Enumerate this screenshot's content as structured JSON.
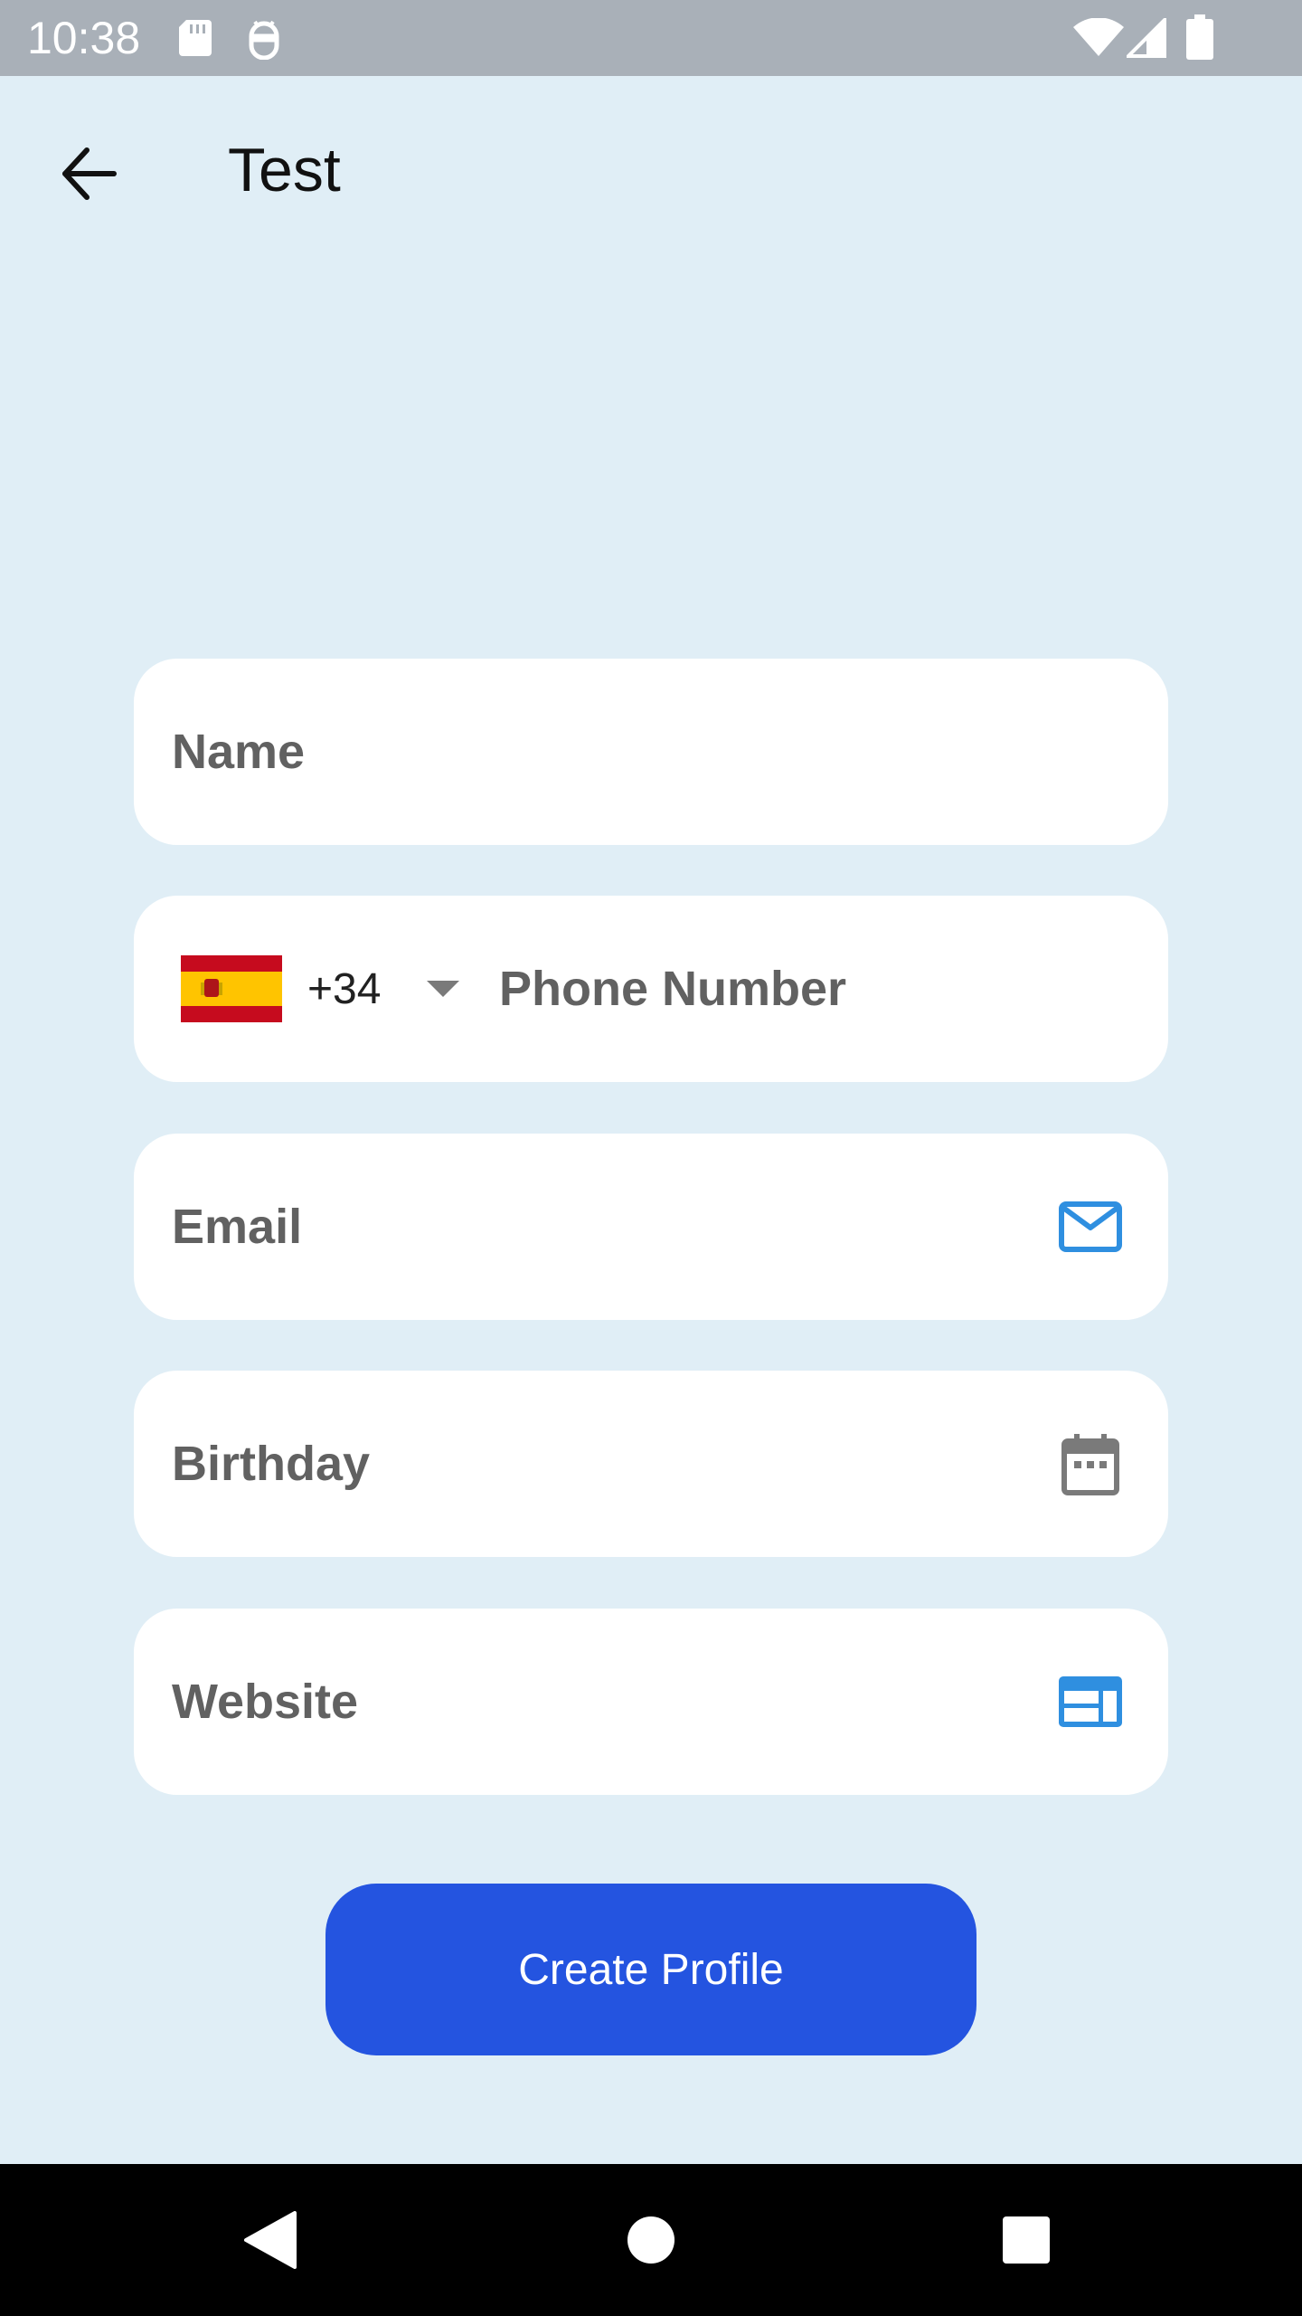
{
  "status_bar": {
    "time": "10:38",
    "left_icons": [
      "sd-card-icon",
      "android-debug-icon"
    ],
    "right_icons": [
      "wifi-icon",
      "cell-signal-icon",
      "battery-icon"
    ]
  },
  "app_bar": {
    "back_icon": "arrow-left-icon",
    "title": "Test"
  },
  "form": {
    "name": {
      "placeholder": "Name"
    },
    "phone": {
      "flag_icon": "spain-flag-icon",
      "dial_code": "+34",
      "dropdown_icon": "caret-down-icon",
      "placeholder": "Phone Number"
    },
    "email": {
      "placeholder": "Email",
      "icon": "mail-icon"
    },
    "birthday": {
      "placeholder": "Birthday",
      "icon": "calendar-icon"
    },
    "website": {
      "placeholder": "Website",
      "icon": "web-icon"
    }
  },
  "actions": {
    "create_label": "Create Profile"
  },
  "nav_bar": {
    "items": [
      "back-triangle-icon",
      "home-circle-icon",
      "recents-square-icon"
    ]
  },
  "colors": {
    "background": "#E0EEF6",
    "status_bar": "#A9B0B8",
    "primary_button": "#2454E0",
    "accent_icon": "#2F8FE0",
    "muted_icon": "#7A7A7A",
    "label_text": "#616161"
  }
}
